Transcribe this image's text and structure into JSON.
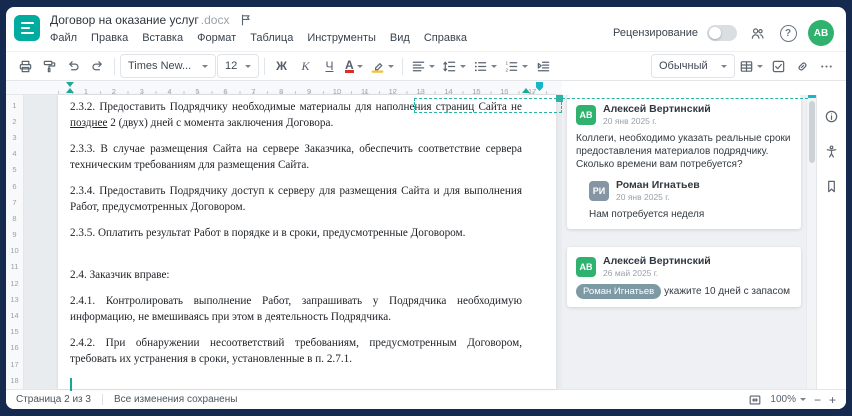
{
  "window": {
    "title": "Договор на оказание услуг",
    "extension": ".docx"
  },
  "menubar": {
    "items": [
      "Файл",
      "Правка",
      "Вставка",
      "Формат",
      "Таблица",
      "Инструменты",
      "Вид",
      "Справка"
    ]
  },
  "topbar": {
    "review_label": "Рецензирование",
    "help_glyph": "?",
    "avatar_initials": "АВ"
  },
  "toolbar": {
    "font_family": "Times New...",
    "font_size": "12",
    "bold": "Ж",
    "italic": "К",
    "underline": "Ч",
    "font_color": "А",
    "style_name": "Обычный"
  },
  "ruler": {
    "horizontal": [
      "1",
      "2",
      "3",
      "4",
      "5",
      "6",
      "7",
      "8",
      "9",
      "10",
      "11",
      "12",
      "13",
      "14",
      "15",
      "16",
      "17"
    ],
    "vertical": [
      "1",
      "2",
      "3",
      "4",
      "5",
      "6",
      "7",
      "8",
      "9",
      "10",
      "11",
      "12",
      "13",
      "14",
      "15",
      "16",
      "17",
      "18"
    ]
  },
  "document": {
    "p1_pre": "2.3.2. Предоставить Подрядчику необходимые материалы для наполнения страниц Сайта не ",
    "p1_underlined": "позднее",
    "p1_post": " 2 (двух) дней с момента заключения Договора.",
    "p2": "2.3.3. В случае размещения Сайта на сервере Заказчика, обеспечить соответствие сервера техническим требованиям для размещения Сайта.",
    "p3": "2.3.4. Предоставить Подрядчику доступ к серверу для размещения Сайта и для выполнения Работ, предусмотренных Договором.",
    "p4": "2.3.5. Оплатить результат Работ в порядке и в сроки, предусмотренные Договором.",
    "p5": "2.4. Заказчик вправе:",
    "p6": "2.4.1. Контролировать выполнение Работ, запрашивать у Подрядчика необходимую информацию, не вмешиваясь при этом в деятельность Подрядчика.",
    "p7": "2.4.2. При обнаружении несоответствий требованиям, предусмотренным Договором, требовать их устранения в сроки, установленные в п. 2.7.1."
  },
  "comments": {
    "thread1": {
      "author": "Алексей Вертинский",
      "initials": "АВ",
      "date": "20 янв 2025 г.",
      "text": "Коллеги, необходимо указать реальные сроки предоставления материалов подрядчику. Сколько времени вам потребуется?",
      "reply": {
        "author": "Роман Игнатьев",
        "initials": "РИ",
        "date": "20 янв 2025 г.",
        "text": "Нам потребуется неделя"
      }
    },
    "thread2": {
      "author": "Алексей Вертинский",
      "initials": "АВ",
      "date": "26 май 2025 г.",
      "mention": "Роман Игнатьев",
      "text": "укажите 10 дней с запасом"
    }
  },
  "statusbar": {
    "page_info": "Страница 2 из 3",
    "save_status": "Все изменения сохранены",
    "zoom": "100%",
    "zoom_out": "−",
    "zoom_in": "+"
  },
  "colors": {
    "accent_teal": "#00ab9f",
    "avatar_green": "#2fb26e",
    "avatar_slate": "#8595a3",
    "frame_navy": "#16294e"
  }
}
